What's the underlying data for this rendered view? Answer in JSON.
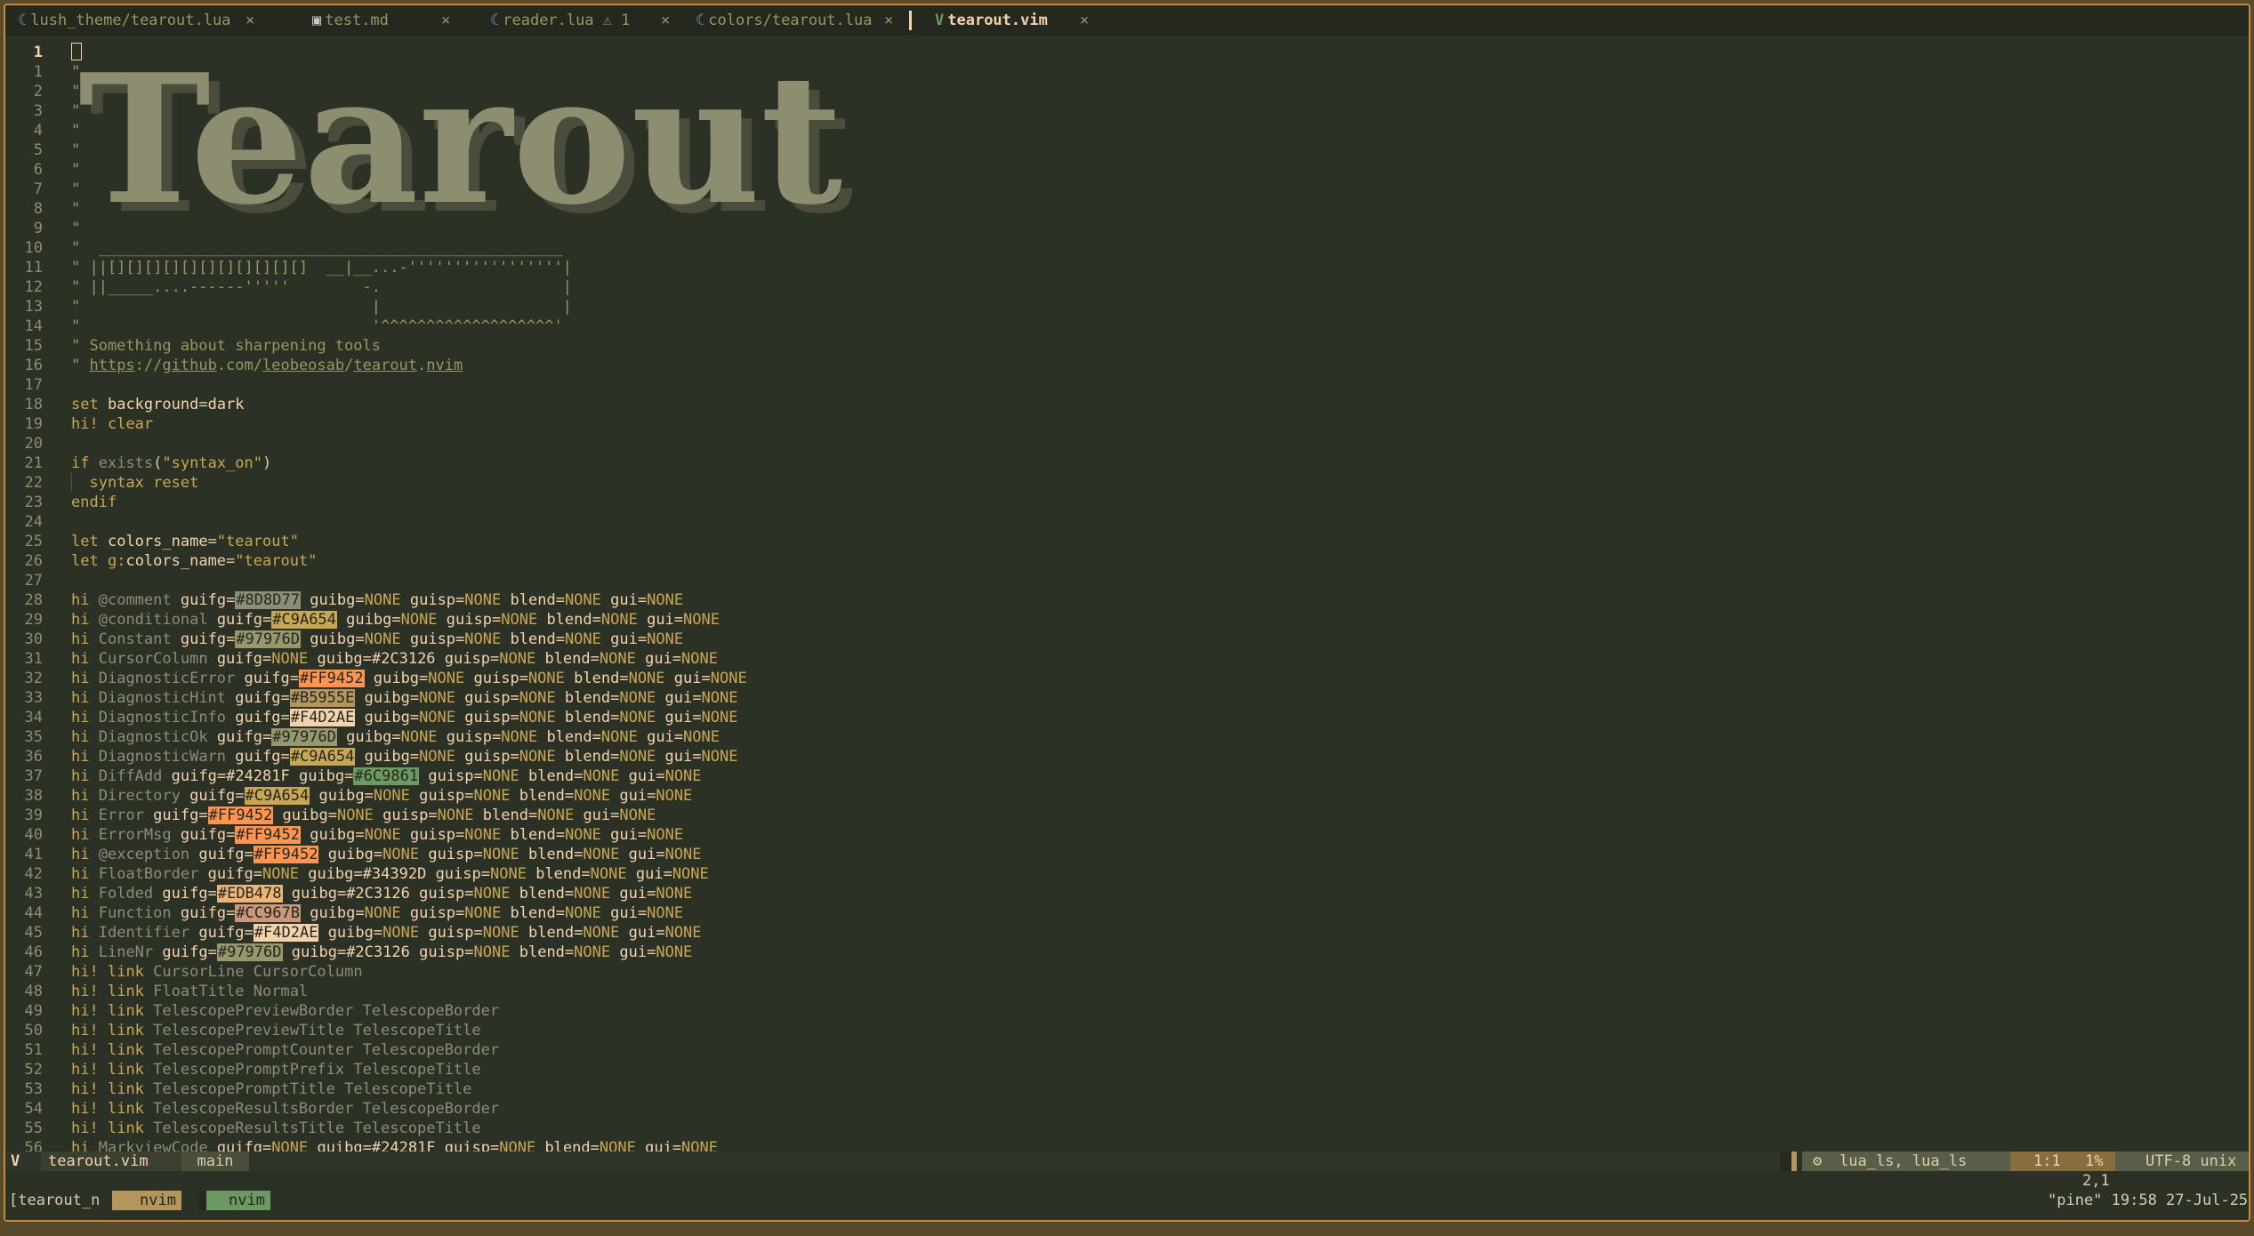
{
  "tabs": [
    {
      "icon": "lua",
      "label": "lush_theme/tearout.lua",
      "close": "×",
      "warning": ""
    },
    {
      "icon": "md",
      "label": "test.md",
      "close": "×",
      "warning": ""
    },
    {
      "icon": "lua",
      "label": "reader.lua",
      "close": "×",
      "warning": "⚠ 1"
    },
    {
      "icon": "lua",
      "label": "colors/tearout.lua",
      "close": "×",
      "warning": ""
    },
    {
      "icon": "vim",
      "label": "tearout.vim",
      "close": "×",
      "warning": "",
      "active": true
    }
  ],
  "icons": {
    "lua": "☾",
    "md": "▣",
    "vim": "V",
    "warning": "warning-icon",
    "close": "close-icon",
    "gear": "⚙"
  },
  "ascii_title": "Tearout",
  "lines": [
    "",
    "\"",
    "\"",
    "\"",
    "\"",
    "\"",
    "\"",
    "\"",
    "\"",
    "\"",
    "\"  ___________________________________________________",
    "\" ||[][][][][][][][][][][]  __|__...-'''''''''''''''''|",
    "\" ||_____....------'''''        -.                    |",
    "\"                                |                    |",
    "\"                                '^^^^^^^^^^^^^^^^^^^'",
    "\" Something about sharpening tools",
    "\" https://github.com/leobeosab/tearout.nvim",
    "",
    "set background=dark",
    "hi! clear",
    "",
    "if exists(\"syntax_on\")",
    "  syntax reset",
    "endif",
    "",
    "let colors_name=\"tearout\"",
    "let g:colors_name=\"tearout\"",
    "",
    "hi @comment guifg=#8D8D77 guibg=NONE guisp=NONE blend=NONE gui=NONE",
    "hi @conditional guifg=#C9A654 guibg=NONE guisp=NONE blend=NONE gui=NONE",
    "hi Constant guifg=#97976D guibg=NONE guisp=NONE blend=NONE gui=NONE",
    "hi CursorColumn guifg=NONE guibg=#2C3126 guisp=NONE blend=NONE gui=NONE",
    "hi DiagnosticError guifg=#FF9452 guibg=NONE guisp=NONE blend=NONE gui=NONE",
    "hi DiagnosticHint guifg=#B5955E guibg=NONE guisp=NONE blend=NONE gui=NONE",
    "hi DiagnosticInfo guifg=#F4D2AE guibg=NONE guisp=NONE blend=NONE gui=NONE",
    "hi DiagnosticOk guifg=#97976D guibg=NONE guisp=NONE blend=NONE gui=NONE",
    "hi DiagnosticWarn guifg=#C9A654 guibg=NONE guisp=NONE blend=NONE gui=NONE",
    "hi DiffAdd guifg=#24281F guibg=#6C9861 guisp=NONE blend=NONE gui=NONE",
    "hi Directory guifg=#C9A654 guibg=NONE guisp=NONE blend=NONE gui=NONE",
    "hi Error guifg=#FF9452 guibg=NONE guisp=NONE blend=NONE gui=NONE",
    "hi ErrorMsg guifg=#FF9452 guibg=NONE guisp=NONE blend=NONE gui=NONE",
    "hi @exception guifg=#FF9452 guibg=NONE guisp=NONE blend=NONE gui=NONE",
    "hi FloatBorder guifg=NONE guibg=#34392D guisp=NONE blend=NONE gui=NONE",
    "hi Folded guifg=#EDB478 guibg=#2C3126 guisp=NONE blend=NONE gui=NONE",
    "hi Function guifg=#CC967B guibg=NONE guisp=NONE blend=NONE gui=NONE",
    "hi Identifier guifg=#F4D2AE guibg=NONE guisp=NONE blend=NONE gui=NONE",
    "hi LineNr guifg=#97976D guibg=#2C3126 guisp=NONE blend=NONE gui=NONE",
    "hi! link CursorLine CursorColumn",
    "hi! link FloatTitle Normal",
    "hi! link TelescopePreviewBorder TelescopeBorder",
    "hi! link TelescopePreviewTitle TelescopeTitle",
    "hi! link TelescopePromptCounter TelescopeBorder",
    "hi! link TelescopePromptPrefix TelescopeTitle",
    "hi! link TelescopePromptTitle TelescopeTitle",
    "hi! link TelescopeResultsBorder TelescopeBorder",
    "hi! link TelescopeResultsTitle TelescopeTitle",
    "hi MarkviewCode guifg=NONE guibg=#24281F guisp=NONE blend=NONE gui=NONE"
  ],
  "current_line": 1,
  "status": {
    "mode_icon": "V",
    "filename": "tearout.vim",
    "branch": "main",
    "lsp": "lua_ls, lua_ls",
    "position": "1:1",
    "percent": "1%",
    "encoding": "UTF-8 unix"
  },
  "ruler": "2,1",
  "tmux": {
    "session": "[tearout_n",
    "windows": [
      "nvim",
      "nvim"
    ],
    "right": "\"pine\" 19:58 27-Jul-25"
  },
  "colors": {
    "bg": "#2C3126",
    "bg_dark": "#24281F",
    "fg": "#D8CDB0",
    "comment": "#979760",
    "keyword": "#C9A654",
    "accent": "#F4D2AE",
    "green": "#6C9861",
    "border": "#c28a3c"
  }
}
